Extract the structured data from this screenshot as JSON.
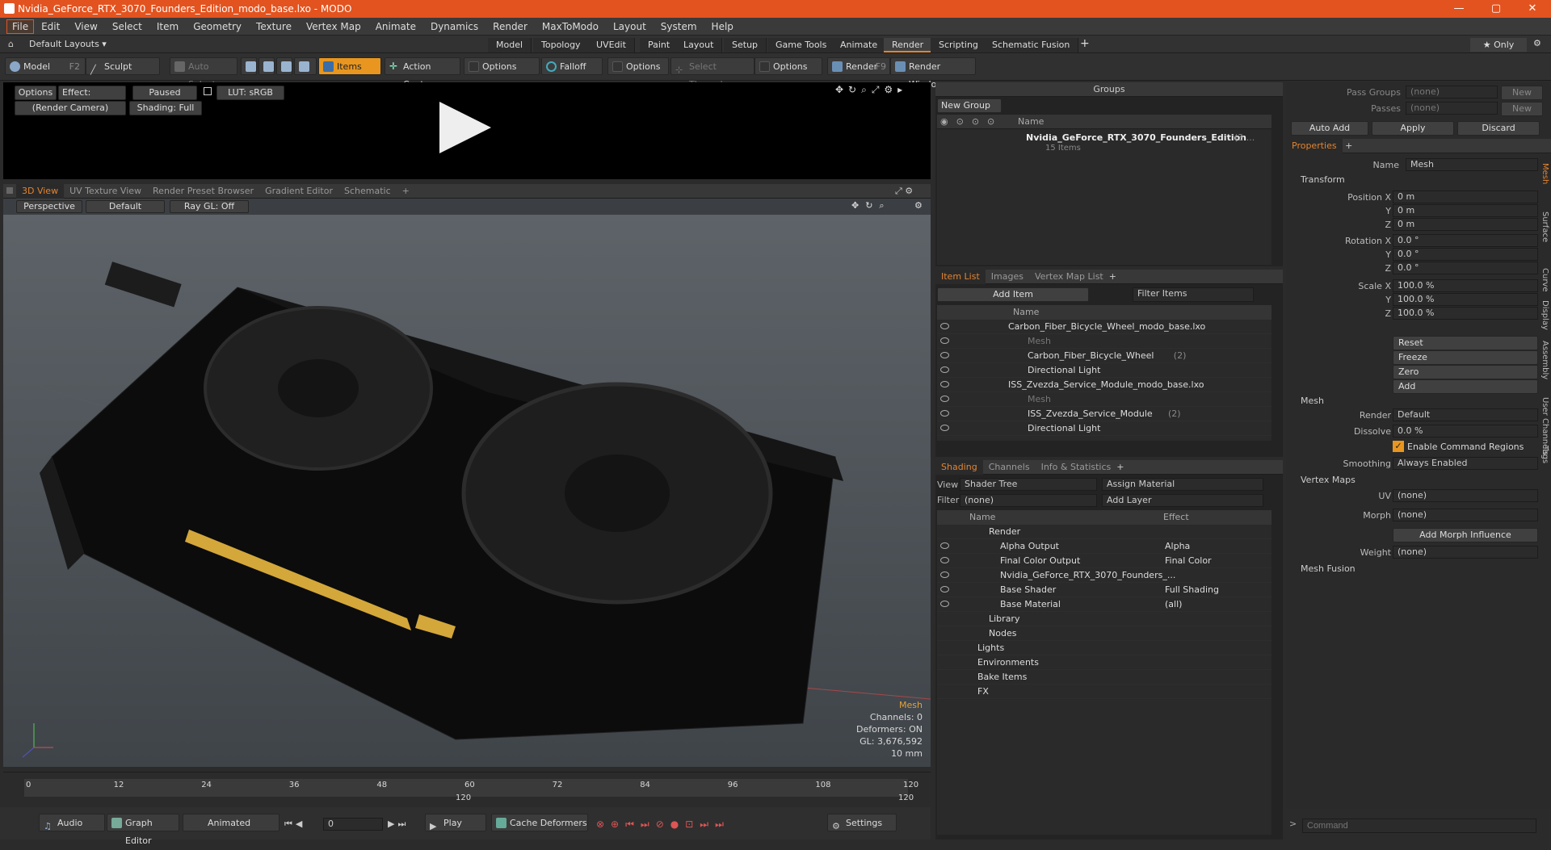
{
  "window": {
    "title": "Nvidia_GeForce_RTX_3070_Founders_Edition_modo_base.lxo - MODO",
    "min": "—",
    "max": "▢",
    "close": "✕"
  },
  "menu": [
    "File",
    "Edit",
    "View",
    "Select",
    "Item",
    "Geometry",
    "Texture",
    "Vertex Map",
    "Animate",
    "Dynamics",
    "Render",
    "MaxToModo",
    "Layout",
    "System",
    "Help"
  ],
  "layouts": {
    "default": "Default Layouts ▾",
    "tabs": [
      "Model",
      "Topology",
      "UVEdit",
      "Paint",
      "Layout",
      "Setup",
      "Game Tools",
      "Animate",
      "Render",
      "Scripting",
      "Schematic Fusion"
    ],
    "active": "Render",
    "plus": "+",
    "only": "★ Only"
  },
  "toolbar": {
    "model": "Model",
    "model_key": "F2",
    "sculpt": "Sculpt",
    "auto_select": "Auto Select",
    "items": "Items",
    "action_center": "Action Center",
    "options1": "Options",
    "falloff": "Falloff",
    "options2": "Options",
    "select_through": "Select Through",
    "options3": "Options",
    "render": "Render",
    "render_key": "F9",
    "render_window": "Render Window"
  },
  "render_view": {
    "options": "Options",
    "effect": "Effect: (Shadi...",
    "paused": "Paused",
    "lut": "LUT: sRGB",
    "camera": "(Render Camera)",
    "shading": "Shading: Full"
  },
  "view_tabs": {
    "tabs": [
      "3D View",
      "UV Texture View",
      "Render Preset Browser",
      "Gradient Editor",
      "Schematic"
    ],
    "active": "3D View",
    "plus": "+"
  },
  "viewport": {
    "perspective": "Perspective",
    "default": "Default",
    "raygl": "Ray GL: Off",
    "info": {
      "type": "Mesh",
      "channels": "Channels: 0",
      "deformers": "Deformers: ON",
      "gl": "GL: 3,676,592",
      "size": "10 mm"
    }
  },
  "timeline": {
    "ticks": [
      "0",
      "12",
      "24",
      "36",
      "48",
      "60",
      "72",
      "84",
      "96",
      "108",
      "120"
    ],
    "end_a": "120",
    "end_b": "120"
  },
  "bottombar": {
    "audio": "Audio",
    "graph_editor": "Graph Editor",
    "animated": "Animated",
    "frame": "0",
    "play": "Play",
    "cache": "Cache Deformers",
    "settings": "Settings"
  },
  "groups": {
    "title": "Groups",
    "new_group": "New Group",
    "name_col": "Name",
    "item": "Nvidia_GeForce_RTX_3070_Founders_Edition",
    "item_count": "(3 ...",
    "sub": "15 Items"
  },
  "item_list": {
    "tabs": [
      "Item List",
      "Images",
      "Vertex Map List"
    ],
    "active": "Item List",
    "plus": "+",
    "add_item": "Add Item",
    "filter": "Filter Items",
    "name_col": "Name",
    "rows": [
      {
        "label": "Carbon_Fiber_Bicycle_Wheel_modo_base.lxo",
        "indent": 0
      },
      {
        "label": "Mesh",
        "indent": 2,
        "dim": true
      },
      {
        "label": "Carbon_Fiber_Bicycle_Wheel",
        "suffix": "(2)",
        "indent": 2
      },
      {
        "label": "Directional Light",
        "indent": 2
      },
      {
        "label": "ISS_Zvezda_Service_Module_modo_base.lxo",
        "indent": 0
      },
      {
        "label": "Mesh",
        "indent": 2,
        "dim": true
      },
      {
        "label": "ISS_Zvezda_Service_Module",
        "suffix": "(2)",
        "indent": 2
      },
      {
        "label": "Directional Light",
        "indent": 2
      }
    ]
  },
  "shading": {
    "tabs": [
      "Shading",
      "Channels",
      "Info & Statistics"
    ],
    "active": "Shading",
    "plus": "+",
    "view_label": "View",
    "view_value": "Shader Tree",
    "assign": "Assign Material",
    "filter_label": "Filter",
    "filter_value": "(none)",
    "add_layer": "Add Layer",
    "name_col": "Name",
    "effect_col": "Effect",
    "rows": [
      {
        "label": "Render",
        "effect": "",
        "indent": 1
      },
      {
        "label": "Alpha Output",
        "effect": "Alpha",
        "indent": 2
      },
      {
        "label": "Final Color Output",
        "effect": "Final Color",
        "indent": 2
      },
      {
        "label": "Nvidia_GeForce_RTX_3070_Founders_...",
        "effect": "",
        "indent": 2
      },
      {
        "label": "Base Shader",
        "effect": "Full Shading",
        "indent": 2
      },
      {
        "label": "Base Material",
        "effect": "(all)",
        "indent": 2
      },
      {
        "label": "Library",
        "effect": "",
        "indent": 1
      },
      {
        "label": "Nodes",
        "effect": "",
        "indent": 1
      },
      {
        "label": "Lights",
        "effect": "",
        "indent": 0
      },
      {
        "label": "Environments",
        "effect": "",
        "indent": 0
      },
      {
        "label": "Bake Items",
        "effect": "",
        "indent": 0
      },
      {
        "label": "FX",
        "effect": "",
        "indent": 0
      }
    ]
  },
  "pass": {
    "groups_label": "Pass Groups",
    "groups_value": "(none)",
    "passes_label": "Passes",
    "passes_value": "(none)",
    "new1": "New",
    "new2": "New",
    "auto_add": "Auto Add",
    "apply": "Apply",
    "discard": "Discard"
  },
  "properties": {
    "tab": "Properties",
    "plus": "+",
    "name_label": "Name",
    "name_value": "Mesh",
    "transform": "Transform",
    "position_label": "Position X",
    "pos": [
      "0 m",
      "0 m",
      "0 m"
    ],
    "rotation_label": "Rotation X",
    "rot": [
      "0.0 °",
      "0.0 °",
      "0.0 °"
    ],
    "scale_label": "Scale X",
    "scl": [
      "100.0 %",
      "100.0 %",
      "100.0 %"
    ],
    "y": "Y",
    "z": "Z",
    "reset": "Reset",
    "freeze": "Freeze",
    "zero": "Zero",
    "add": "Add",
    "mesh": "Mesh",
    "render_label": "Render",
    "render_value": "Default",
    "dissolve_label": "Dissolve",
    "dissolve_value": "0.0 %",
    "enable_cmd": "Enable Command Regions",
    "smoothing_label": "Smoothing",
    "smoothing_value": "Always Enabled",
    "vertex_maps": "Vertex Maps",
    "uv_label": "UV",
    "uv_value": "(none)",
    "morph_label": "Morph",
    "morph_value": "(none)",
    "add_morph": "Add Morph Influence",
    "weight_label": "Weight",
    "weight_value": "(none)",
    "mesh_fusion": "Mesh Fusion",
    "side_tabs": [
      "Mesh",
      "Surface",
      "Curve",
      "Display",
      "Assembly",
      "User Channels",
      "Tags"
    ]
  },
  "command": {
    "placeholder": "Command"
  },
  "colors": {
    "accent": "#e3531f",
    "orange": "#e3842f"
  }
}
